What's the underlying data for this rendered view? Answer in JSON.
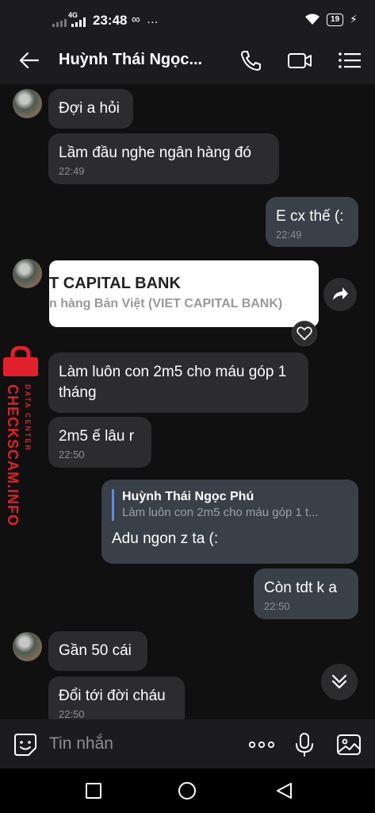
{
  "status_bar": {
    "network": "4G",
    "time": "23:48",
    "extra_icons": "…",
    "battery": "19"
  },
  "header": {
    "title": "Huỳnh Thái Ngọc...",
    "icons": [
      "back-arrow-icon",
      "phone-icon",
      "video-icon",
      "menu-icon"
    ]
  },
  "messages": [
    {
      "dir": "in",
      "text": "Đợi a hỏi",
      "time": ""
    },
    {
      "dir": "in",
      "text": "Lầm đầu nghe ngân hàng đó",
      "time": "22:49"
    },
    {
      "dir": "out",
      "text": "E cx thế (:",
      "time": "22:49"
    },
    {
      "dir": "in",
      "text": "Làm luôn con 2m5 cho máu góp 1 tháng",
      "time": ""
    },
    {
      "dir": "in",
      "text": "2m5 ế lâu r",
      "time": "22:50"
    },
    {
      "dir": "out",
      "text": "Adu ngon z ta (:",
      "time": ""
    },
    {
      "dir": "out",
      "text": "Còn tdt k a",
      "time": "22:50"
    },
    {
      "dir": "in",
      "text": "Gần 50 cái",
      "time": ""
    },
    {
      "dir": "in",
      "text": "Đổi tới đời cháu",
      "time": "22:50"
    }
  ],
  "link_card": {
    "title": "T CAPITAL BANK",
    "subtitle": "n hàng  Bản Việt (VIET CAPITAL BANK)"
  },
  "quote": {
    "name": "Huỳnh Thái Ngọc Phú",
    "text": "Làm luôn con 2m5 cho máu góp 1 t..."
  },
  "watermark": {
    "main": "CHECKSCAM.INFO",
    "small": "DATA CENTER"
  },
  "composer": {
    "placeholder": "Tin nhắn"
  },
  "colors": {
    "background": "#101010",
    "bubble_in": "#2c2c2e",
    "bubble_out": "#3a4048",
    "quote_bar": "#4f8cff",
    "watermark": "#e0202a"
  }
}
